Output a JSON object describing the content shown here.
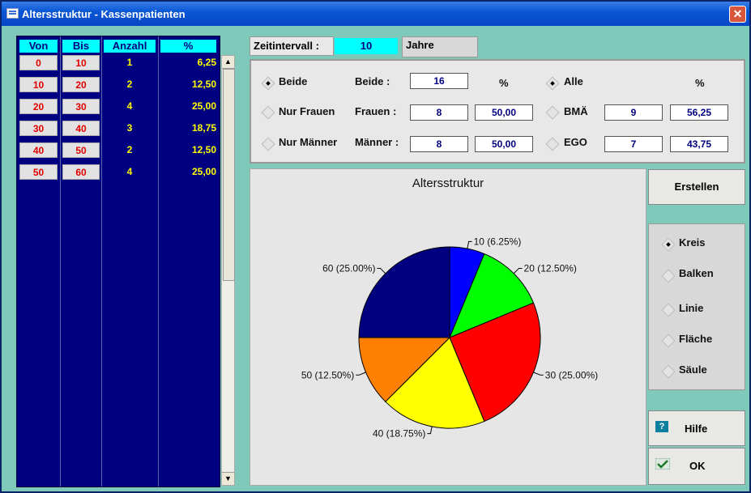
{
  "window": {
    "title": "Altersstruktur - Kassenpatienten",
    "close_glyph": "✕"
  },
  "table": {
    "headers": [
      "Von",
      "Bis",
      "Anzahl",
      "%"
    ],
    "rows": [
      {
        "von": "0",
        "bis": "10",
        "anzahl": "1",
        "pct": "6,25"
      },
      {
        "von": "10",
        "bis": "20",
        "anzahl": "2",
        "pct": "12,50"
      },
      {
        "von": "20",
        "bis": "30",
        "anzahl": "4",
        "pct": "25,00"
      },
      {
        "von": "30",
        "bis": "40",
        "anzahl": "3",
        "pct": "18,75"
      },
      {
        "von": "40",
        "bis": "50",
        "anzahl": "2",
        "pct": "12,50"
      },
      {
        "von": "50",
        "bis": "60",
        "anzahl": "4",
        "pct": "25,00"
      }
    ],
    "scroll_up": "▲",
    "scroll_down": "▼"
  },
  "zeitintervall": {
    "label": "Zeitintervall :",
    "value": "10",
    "unit": "Jahre"
  },
  "filter": {
    "beide_radio": "Beide",
    "frauen_radio": "Nur Frauen",
    "maenner_radio": "Nur Männer",
    "beide_label": "Beide :",
    "frauen_label": "Frauen :",
    "maenner_label": "Männer :",
    "beide_value": "16",
    "frauen_value": "8",
    "frauen_pct": "50,00",
    "maenner_value": "8",
    "maenner_pct": "50,00",
    "pct_header_1": "%",
    "alle_radio": "Alle",
    "bma_radio": "BMÄ",
    "ego_radio": "EGO",
    "pct_header_2": "%",
    "bma_value": "9",
    "bma_pct": "56,25",
    "ego_value": "7",
    "ego_pct": "43,75"
  },
  "chart_data": {
    "type": "pie",
    "title": "Altersstruktur",
    "slices": [
      {
        "label": "10 (6.25%)",
        "value": 6.25,
        "color": "#0000ff"
      },
      {
        "label": "20 (12.50%)",
        "value": 12.5,
        "color": "#00ff00"
      },
      {
        "label": "30 (25.00%)",
        "value": 25.0,
        "color": "#ff0000"
      },
      {
        "label": "40 (18.75%)",
        "value": 18.75,
        "color": "#ffff00"
      },
      {
        "label": "50 (12.50%)",
        "value": 12.5,
        "color": "#ff8000"
      },
      {
        "label": "60 (25.00%)",
        "value": 25.0,
        "color": "#000080"
      }
    ]
  },
  "buttons": {
    "erstellen": "Erstellen",
    "hilfe": "Hilfe",
    "ok": "OK"
  },
  "chart_types": {
    "kreis": "Kreis",
    "balken": "Balken",
    "linie": "Linie",
    "flaeche": "Fläche",
    "saeule": "Säule"
  },
  "icons": {
    "app": "form-icon",
    "close": "close-icon",
    "hilfe": "help-icon",
    "ok": "checkmark-icon"
  }
}
